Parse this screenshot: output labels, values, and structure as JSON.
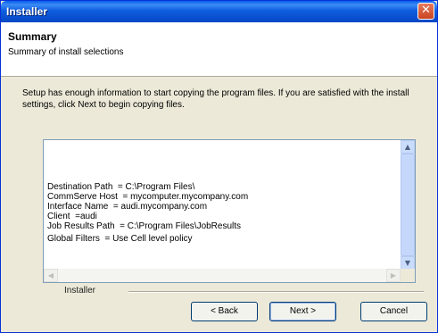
{
  "window": {
    "title": "Installer"
  },
  "header": {
    "title": "Summary",
    "subtitle": "Summary of install selections"
  },
  "intro_text": "Setup has enough information to start copying the program files.  If you are satisfied with the install settings, click Next to begin copying files.",
  "summary_lines": [
    "Destination Path  = C:\\Program Files\\",
    "CommServe Host  = mycomputer.mycompany.com",
    "Interface Name  = audi.mycompany.com",
    "Client  =audi",
    "Job Results Path  = C:\\Program Files\\JobResults",
    "Global Filters  = Use Cell level policy"
  ],
  "footer": {
    "label": "Installer"
  },
  "buttons": {
    "back": "< Back",
    "next": "Next >",
    "cancel": "Cancel"
  },
  "icons": {
    "close": "close-icon",
    "scroll_up": "arrow-up-icon",
    "scroll_down": "arrow-down-icon",
    "scroll_left": "arrow-left-icon",
    "scroll_right": "arrow-right-icon"
  },
  "colors": {
    "titlebar": "#0a5fe8",
    "window_bg": "#ece9d8",
    "close_button": "#c9431e"
  }
}
